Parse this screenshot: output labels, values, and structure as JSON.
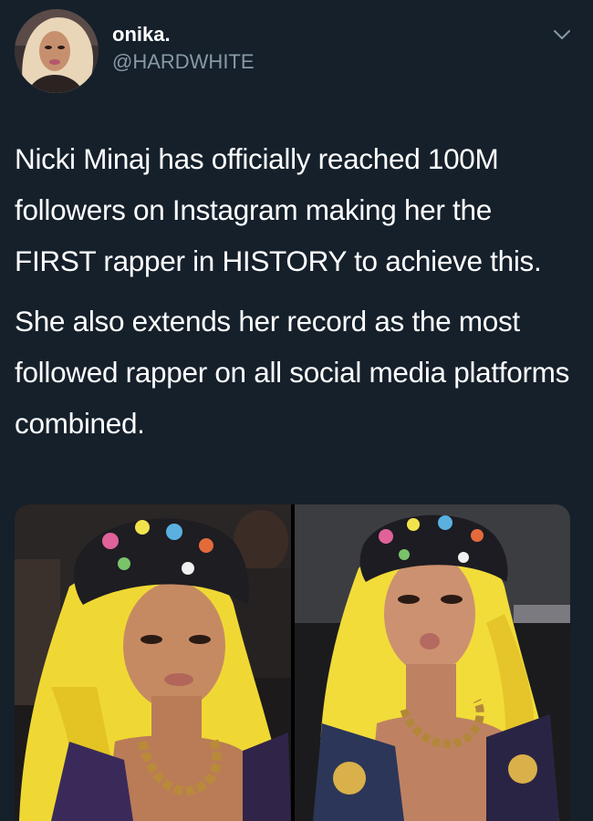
{
  "user": {
    "display_name": "onika.",
    "handle": "@HARDWHITE",
    "avatar_icon": "profile-photo"
  },
  "menu": {
    "caret_icon": "chevron-down-icon"
  },
  "tweet": {
    "paragraphs": [
      "Nicki Minaj has officially reached 100M followers on Instagram making her the FIRST rapper in HISTORY to achieve this.",
      "She also extends her record as the most followed rapper on all social media platforms combined."
    ]
  },
  "colors": {
    "background": "#15202b",
    "text_primary": "#ffffff",
    "text_secondary": "#8899a6",
    "hair": "#f2df3a",
    "skin": "#c98d6a"
  },
  "media": {
    "photos": [
      {
        "alt_icon": "photo-woman-yellow-hair-left"
      },
      {
        "alt_icon": "photo-woman-yellow-hair-right"
      }
    ]
  }
}
